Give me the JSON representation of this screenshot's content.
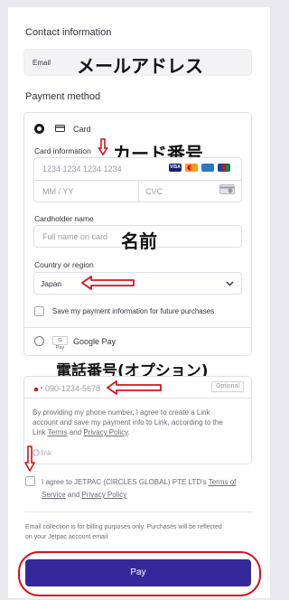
{
  "contact": {
    "section_title": "Contact information",
    "email_label": "Email",
    "email_annotation": "メールアドレス"
  },
  "payment": {
    "section_title": "Payment method",
    "card_option_label": "Card",
    "card_info_label": "Card information",
    "card_info_annotation": "カード番号",
    "card_number_placeholder": "1234 1234 1234 1234",
    "expiry_placeholder": "MM / YY",
    "cvc_placeholder": "CVC",
    "card_brands": [
      "VISA",
      "MC",
      "AMEX",
      "JCB"
    ],
    "cardholder_label": "Cardholder name",
    "cardholder_placeholder": "Full name on card",
    "cardholder_annotation": "名前",
    "country_label": "Country or region",
    "country_value": "Japan",
    "save_info_label": "Save my payment information for future purchases",
    "google_pay_badge": "G Pay",
    "google_pay_label": "Google Pay"
  },
  "link": {
    "phone_annotation": "電話番号(オプション)",
    "phone_placeholder": "090-1234-5678",
    "optional_badge": "Optional",
    "terms_line1": "By providing my phone number, I agree to create a Link",
    "terms_line2": "account and save my payment info to Link, according to the",
    "terms_line3_pre": "Link ",
    "terms_link": "Terms",
    "terms_and": " and ",
    "privacy_link": "Privacy Policy",
    "terms_end": ".",
    "link_logo": "link"
  },
  "agreement": {
    "line1_pre": "I agree to JETPAC (CIRCLES GLOBAL) PTE LTD's ",
    "terms_of": "Terms of",
    "service": "Service",
    "and": " and ",
    "privacy": "Privacy Policy"
  },
  "footer": {
    "note_line1": "Email collection is for billing purposes only. Purchases will be reflected",
    "note_line2": "on your Jetpac account email.",
    "pay_label": "Pay"
  },
  "colors": {
    "pay_button": "#35289a",
    "annotation_red": "#d9121b",
    "visa": "#1a1f71",
    "mastercard": "#eb001b",
    "amex": "#2e77bc",
    "jcb": "#0e4c96"
  }
}
